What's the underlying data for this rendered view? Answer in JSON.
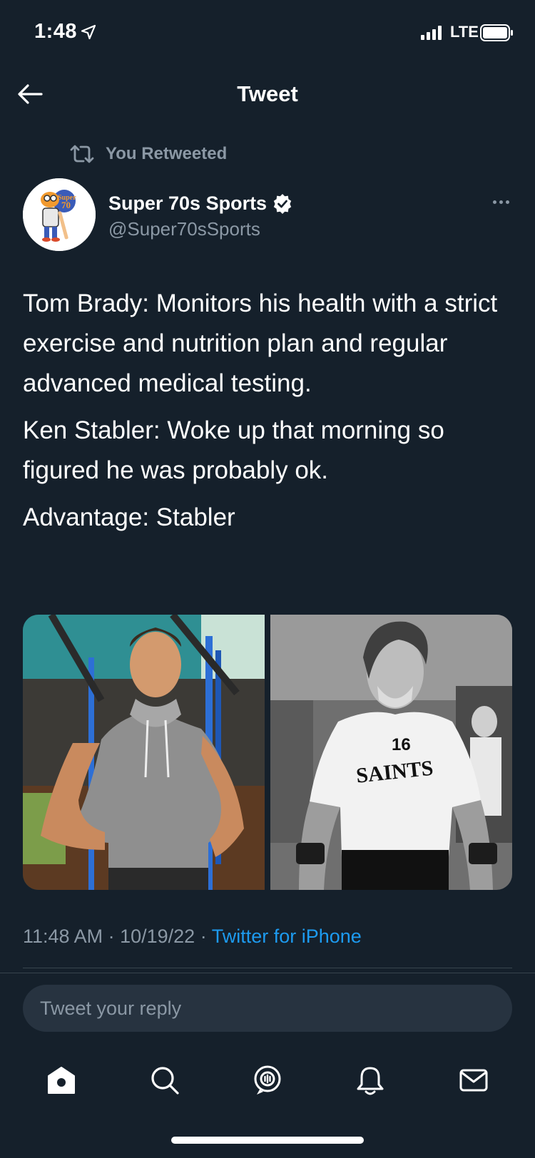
{
  "status_bar": {
    "time": "1:48",
    "carrier": "LTE"
  },
  "header": {
    "title": "Tweet"
  },
  "retweet": {
    "label": "You Retweeted"
  },
  "author": {
    "name": "Super 70s Sports",
    "handle": "@Super70sSports"
  },
  "tweet": {
    "paragraphs": [
      "Tom Brady: Monitors his health with a strict exercise and nutrition plan and regular advanced medical testing.",
      "Ken Stabler: Woke up that morning so figured he was probably ok.",
      "Advantage: Stabler"
    ],
    "time": "11:48 AM",
    "date": "10/19/22",
    "source": "Twitter for iPhone",
    "photo_jersey_number": "16",
    "photo_jersey_text": "SAINTS"
  },
  "reply": {
    "placeholder": "Tweet your reply"
  },
  "tabs": [
    "home-icon",
    "search-icon",
    "spaces-icon",
    "notifications-icon",
    "messages-icon"
  ],
  "colors": {
    "background": "#15202b",
    "accent": "#1d9bf0",
    "secondary_text": "#8b98a5"
  }
}
